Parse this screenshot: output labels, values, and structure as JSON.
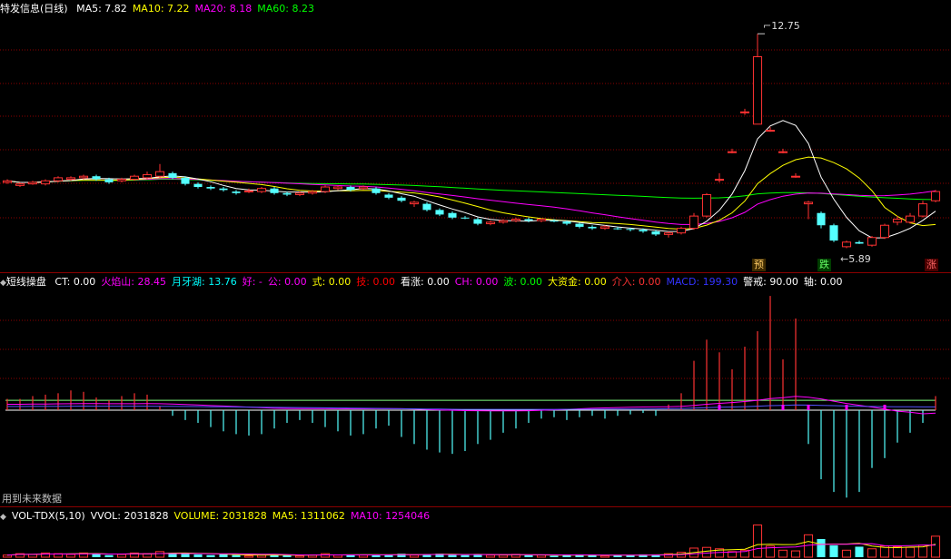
{
  "stock": {
    "name": "特发信息(日线)"
  },
  "price_panel": {
    "indicators": [
      {
        "label": "MA5:",
        "value": "7.82",
        "color": "#ffffff"
      },
      {
        "label": "MA10:",
        "value": "7.22",
        "color": "#ffff00"
      },
      {
        "label": "MA20:",
        "value": "8.18",
        "color": "#ff00ff"
      },
      {
        "label": "MA60:",
        "value": "8.23",
        "color": "#00ff00"
      }
    ],
    "high_label": "12.75",
    "low_label": "5.89",
    "signals": {
      "yu": "预",
      "die": "跌",
      "zhang": "涨"
    }
  },
  "indicator_panel": {
    "title": "短线操盘",
    "items": [
      {
        "label": "CT:",
        "value": "0.00",
        "color": "#ffffff"
      },
      {
        "label": "火焰山:",
        "value": "28.45",
        "color": "#ff00ff"
      },
      {
        "label": "月牙湖:",
        "value": "13.76",
        "color": "#00ffff"
      },
      {
        "label": "好:",
        "value": "-",
        "color": "#ff00ff"
      },
      {
        "label": "公:",
        "value": "0.00",
        "color": "#ff00ff"
      },
      {
        "label": "式:",
        "value": "0.00",
        "color": "#ffff00"
      },
      {
        "label": "技:",
        "value": "0.00",
        "color": "#ff0000"
      },
      {
        "label": "看涨:",
        "value": "0.00",
        "color": "#ffffff"
      },
      {
        "label": "CH:",
        "value": "0.00",
        "color": "#ff00ff"
      },
      {
        "label": "波:",
        "value": "0.00",
        "color": "#00ff00"
      },
      {
        "label": "大资金:",
        "value": "0.00",
        "color": "#ffff00"
      },
      {
        "label": "介入:",
        "value": "0.00",
        "color": "#ff3333"
      },
      {
        "label": "MACD:",
        "value": "199.30",
        "color": "#3333ff"
      },
      {
        "label": "警戒:",
        "value": "90.00",
        "color": "#ffffff"
      },
      {
        "label": "轴:",
        "value": "0.00",
        "color": "#ffffff"
      }
    ],
    "future_data_note": "用到未来数据"
  },
  "volume_panel": {
    "items": [
      {
        "label": "VOL-TDX(5,10)",
        "value": "",
        "color": "#ffffff"
      },
      {
        "label": "VVOL:",
        "value": "2031828",
        "color": "#ffffff"
      },
      {
        "label": "VOLUME:",
        "value": "2031828",
        "color": "#ffff00"
      },
      {
        "label": "MA5:",
        "value": "1311062",
        "color": "#ffff00"
      },
      {
        "label": "MA10:",
        "value": "1254046",
        "color": "#ff00ff"
      }
    ]
  },
  "colors": {
    "up": "#ff3232",
    "down": "#54ffff",
    "ma5": "#ffffff",
    "ma10": "#ffff00",
    "ma20": "#ff00ff",
    "ma60": "#00ff00",
    "grid": "#8b0000"
  },
  "chart_data": {
    "type": "candlestick",
    "candles": [
      [
        7.9,
        7.95,
        7.85,
        8.0
      ],
      [
        7.8,
        7.85,
        7.75,
        7.9
      ],
      [
        7.85,
        7.9,
        7.82,
        7.95
      ],
      [
        7.85,
        7.95,
        7.8,
        8.0
      ],
      [
        7.95,
        8.05,
        7.9,
        8.1
      ],
      [
        8.0,
        8.05,
        7.95,
        8.1
      ],
      [
        8.05,
        8.1,
        8.0,
        8.15
      ],
      [
        8.1,
        8.0,
        7.95,
        8.15
      ],
      [
        8.0,
        7.9,
        7.85,
        8.05
      ],
      [
        7.95,
        8.0,
        7.9,
        8.05
      ],
      [
        8.0,
        8.1,
        7.95,
        8.15
      ],
      [
        8.05,
        8.15,
        8.0,
        8.25
      ],
      [
        8.1,
        8.25,
        8.05,
        8.5
      ],
      [
        8.2,
        8.05,
        8.0,
        8.25
      ],
      [
        8.05,
        7.85,
        7.8,
        8.1
      ],
      [
        7.85,
        7.75,
        7.7,
        7.9
      ],
      [
        7.75,
        7.7,
        7.65,
        7.8
      ],
      [
        7.7,
        7.65,
        7.6,
        7.75
      ],
      [
        7.6,
        7.55,
        7.5,
        7.65
      ],
      [
        7.6,
        7.62,
        7.55,
        7.7
      ],
      [
        7.6,
        7.7,
        7.55,
        7.75
      ],
      [
        7.7,
        7.55,
        7.5,
        7.75
      ],
      [
        7.55,
        7.5,
        7.45,
        7.6
      ],
      [
        7.5,
        7.55,
        7.45,
        7.6
      ],
      [
        7.55,
        7.6,
        7.5,
        7.65
      ],
      [
        7.6,
        7.75,
        7.55,
        7.8
      ],
      [
        7.7,
        7.75,
        7.65,
        7.8
      ],
      [
        7.75,
        7.65,
        7.6,
        7.8
      ],
      [
        7.7,
        7.75,
        7.65,
        7.8
      ],
      [
        7.7,
        7.55,
        7.5,
        7.75
      ],
      [
        7.5,
        7.4,
        7.35,
        7.55
      ],
      [
        7.4,
        7.3,
        7.25,
        7.45
      ],
      [
        7.2,
        7.25,
        7.1,
        7.3
      ],
      [
        7.2,
        7.0,
        6.95,
        7.25
      ],
      [
        7.0,
        6.85,
        6.8,
        7.05
      ],
      [
        6.9,
        6.75,
        6.7,
        6.95
      ],
      [
        6.75,
        6.72,
        6.7,
        6.8
      ],
      [
        6.7,
        6.55,
        6.5,
        6.75
      ],
      [
        6.55,
        6.6,
        6.5,
        6.65
      ],
      [
        6.6,
        6.65,
        6.55,
        6.7
      ],
      [
        6.65,
        6.7,
        6.6,
        6.75
      ],
      [
        6.7,
        6.65,
        6.6,
        6.75
      ],
      [
        6.65,
        6.7,
        6.6,
        6.72
      ],
      [
        6.65,
        6.62,
        6.6,
        6.7
      ],
      [
        6.62,
        6.55,
        6.5,
        6.65
      ],
      [
        6.55,
        6.45,
        6.4,
        6.58
      ],
      [
        6.45,
        6.4,
        6.35,
        6.5
      ],
      [
        6.4,
        6.45,
        6.35,
        6.5
      ],
      [
        6.4,
        6.38,
        6.35,
        6.45
      ],
      [
        6.38,
        6.35,
        6.3,
        6.42
      ],
      [
        6.35,
        6.3,
        6.25,
        6.4
      ],
      [
        6.3,
        6.2,
        6.15,
        6.35
      ],
      [
        6.2,
        6.25,
        6.1,
        6.3
      ],
      [
        6.25,
        6.4,
        6.2,
        6.45
      ],
      [
        6.4,
        6.8,
        6.35,
        6.9
      ],
      [
        6.8,
        7.5,
        6.75,
        7.55
      ],
      [
        8.0,
        8.0,
        7.9,
        8.2
      ],
      [
        8.9,
        8.9,
        8.85,
        9.0
      ],
      [
        10.2,
        10.2,
        10.1,
        10.3
      ],
      [
        9.8,
        12.0,
        9.8,
        12.75
      ],
      [
        9.6,
        9.6,
        9.55,
        9.7
      ],
      [
        8.9,
        8.9,
        8.85,
        9.0
      ],
      [
        8.1,
        8.1,
        8.05,
        8.2
      ],
      [
        7.2,
        7.25,
        6.7,
        7.3
      ],
      [
        6.9,
        6.5,
        6.4,
        6.95
      ],
      [
        6.5,
        6.0,
        5.95,
        6.55
      ],
      [
        5.8,
        5.95,
        5.75,
        6.0
      ],
      [
        5.95,
        5.9,
        5.89,
        6.0
      ],
      [
        5.85,
        6.1,
        5.8,
        6.15
      ],
      [
        6.1,
        6.5,
        6.05,
        6.55
      ],
      [
        6.6,
        6.7,
        6.5,
        6.8
      ],
      [
        6.6,
        6.8,
        6.55,
        6.9
      ],
      [
        6.8,
        7.2,
        6.75,
        7.3
      ],
      [
        7.3,
        7.6,
        7.25,
        7.65
      ]
    ],
    "candle_format": [
      "open",
      "close",
      "low",
      "high"
    ],
    "signals": {
      "yu": 57,
      "die": 66,
      "zhang": 73
    },
    "volumes": [
      0.3,
      0.5,
      0.4,
      0.6,
      0.5,
      0.4,
      0.6,
      0.5,
      0.3,
      0.4,
      0.6,
      0.5,
      0.8,
      0.6,
      0.5,
      0.4,
      0.3,
      0.4,
      0.3,
      0.2,
      0.3,
      0.4,
      0.3,
      0.2,
      0.3,
      0.5,
      0.3,
      0.4,
      0.3,
      0.3,
      0.4,
      0.5,
      0.3,
      0.4,
      0.5,
      0.4,
      0.3,
      0.4,
      0.3,
      0.3,
      0.4,
      0.3,
      0.3,
      0.2,
      0.3,
      0.4,
      0.3,
      0.2,
      0.3,
      0.3,
      0.4,
      0.4,
      0.5,
      0.7,
      1.3,
      1.4,
      1.2,
      0.8,
      1.0,
      4.6,
      1.6,
      1.0,
      0.9,
      3.2,
      2.6,
      1.7,
      1.0,
      1.5,
      1.2,
      1.6,
      1.5,
      1.4,
      1.7,
      3.0
    ],
    "osc": [
      0.8,
      0.8,
      1.0,
      1.1,
      1.2,
      1.4,
      1.3,
      0.9,
      0.7,
      1.0,
      1.2,
      1.1,
      0.3,
      -0.4,
      -0.7,
      -0.9,
      -1.2,
      -1.5,
      -1.7,
      -1.8,
      -1.7,
      -1.3,
      -0.9,
      -0.7,
      -0.9,
      -1.2,
      -1.5,
      -1.8,
      -1.7,
      -1.3,
      -1.1,
      -1.9,
      -2.4,
      -2.8,
      -3.0,
      -3.1,
      -2.9,
      -2.4,
      -2.1,
      -1.6,
      -1.3,
      -0.9,
      -0.6,
      -0.5,
      -0.7,
      -0.5,
      -0.4,
      -0.6,
      -0.4,
      -0.3,
      -0.2,
      -0.4,
      0.4,
      1.2,
      3.5,
      5.0,
      4.1,
      2.9,
      4.5,
      5.6,
      8.1,
      3.6,
      6.5,
      -2.4,
      -4.9,
      -5.8,
      -6.2,
      -5.8,
      -4.1,
      -3.4,
      -2.3,
      -1.6,
      -0.9,
      1.0
    ],
    "ylim_price": [
      5.5,
      13.2
    ],
    "ylim_osc": [
      -6.5,
      8.3
    ]
  }
}
